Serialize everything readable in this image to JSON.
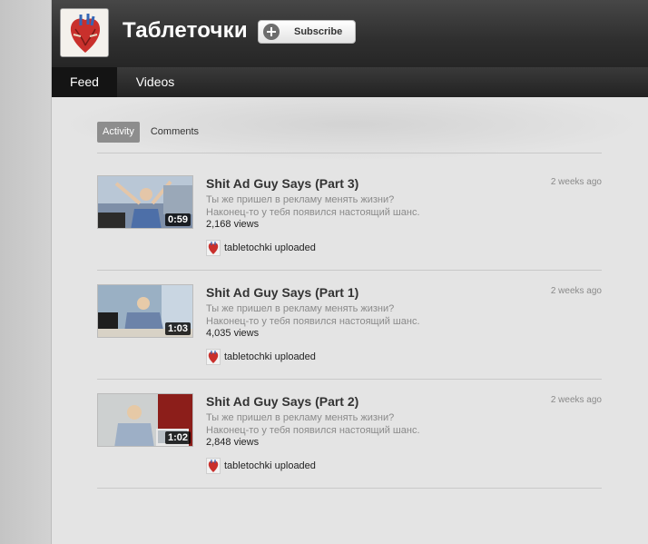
{
  "channel": {
    "title": "Таблеточки",
    "subscribe_label": "Subscribe",
    "avatar_icon": "anatomical-heart-icon"
  },
  "tabs": [
    {
      "label": "Feed",
      "active": true
    },
    {
      "label": "Videos",
      "active": false
    }
  ],
  "subnav": [
    {
      "label": "Activity",
      "active": true
    },
    {
      "label": "Comments",
      "active": false
    }
  ],
  "feed": [
    {
      "title": "Shit Ad Guy Says (Part 3)",
      "desc_line1": "Ты же пришел в рекламу менять жизни?",
      "desc_line2": "Наконец-то у тебя появился настоящий шанс.",
      "views": "2,168 views",
      "duration": "0:59",
      "time": "2 weeks ago",
      "uploader": "tabletochki uploaded"
    },
    {
      "title": "Shit Ad Guy Says (Part 1)",
      "desc_line1": "Ты же пришел в рекламу менять жизни?",
      "desc_line2": "Наконец-то у тебя появился настоящий шанс.",
      "views": "4,035 views",
      "duration": "1:03",
      "time": "2 weeks ago",
      "uploader": "tabletochki uploaded"
    },
    {
      "title": "Shit Ad Guy Says (Part 2)",
      "desc_line1": "Ты же пришел в рекламу менять жизни?",
      "desc_line2": "Наконец-то у тебя появился настоящий шанс.",
      "views": "2,848 views",
      "duration": "1:02",
      "time": "2 weeks ago",
      "uploader": "tabletochki uploaded"
    }
  ],
  "colors": {
    "header_dark": "#2f2f2f",
    "content_bg": "#e4e4e4",
    "active_pill": "#8d8d8d"
  }
}
